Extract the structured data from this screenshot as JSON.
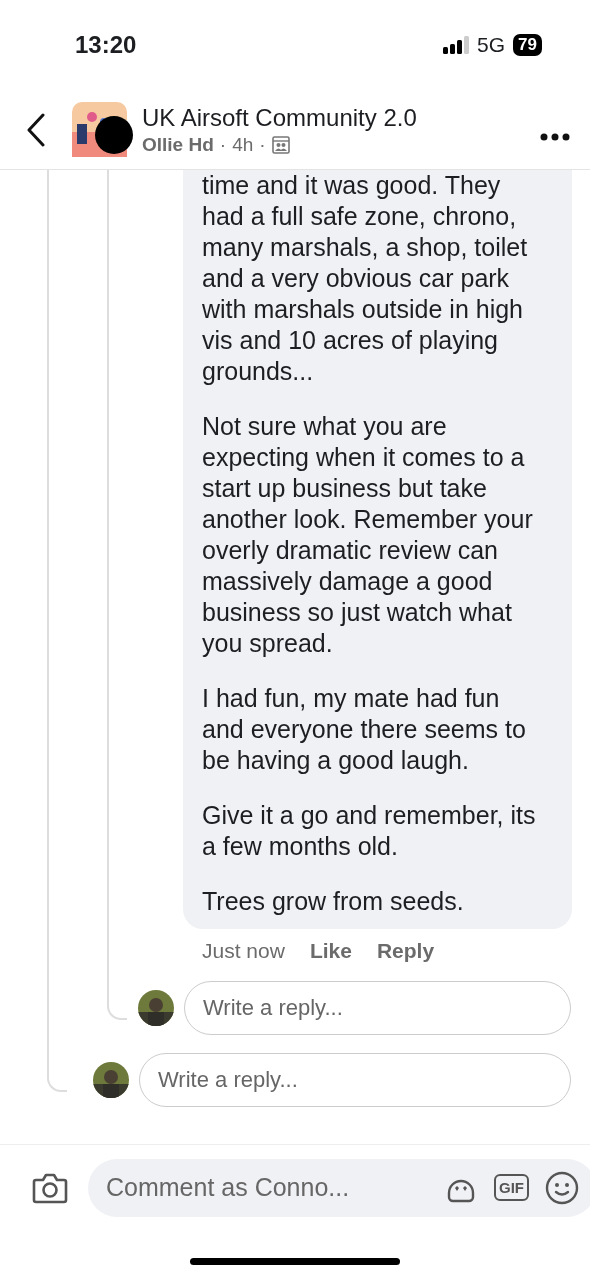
{
  "status_bar": {
    "time": "13:20",
    "network": "5G",
    "battery": "79"
  },
  "header": {
    "title": "UK Airsoft Community 2.0",
    "author": "Ollie Hd",
    "age": "4h",
    "separators": [
      "·",
      "·"
    ]
  },
  "comment": {
    "paragraphs": [
      "time and it was good. They had a full safe zone, chrono, many marshals, a shop, toilet and a very obvious car park with marshals outside in high vis and 10 acres of playing grounds...",
      "Not sure what you are expecting when it comes to a start up business but take another look. Remember your overly dramatic review can massively damage a good business so just watch what you spread.",
      "I had fun, my mate had fun and everyone there seems to be having a good laugh.",
      "Give it a go and remember, its a few months old.",
      "Trees grow from seeds."
    ],
    "time": "Just now",
    "actions": [
      "Like",
      "Reply"
    ]
  },
  "replies": [
    {
      "placeholder": "Write a reply..."
    },
    {
      "placeholder": "Write a reply..."
    }
  ],
  "composer": {
    "placeholder": "Comment as Conno...",
    "gif_label": "GIF"
  }
}
